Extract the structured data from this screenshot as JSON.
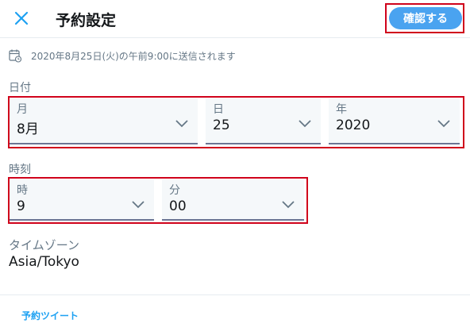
{
  "header": {
    "title": "予約設定",
    "confirm_label": "確認する",
    "close_icon": "close-icon",
    "accent_color": "#1da1f2"
  },
  "schedule": {
    "icon": "calendar-clock-icon",
    "text": "2020年8月25日(火)の午前9:00に送信されます"
  },
  "date": {
    "section_label": "日付",
    "month": {
      "label": "月",
      "value": "8月"
    },
    "day": {
      "label": "日",
      "value": "25"
    },
    "year": {
      "label": "年",
      "value": "2020"
    }
  },
  "time": {
    "section_label": "時刻",
    "hour": {
      "label": "時",
      "value": "9"
    },
    "minute": {
      "label": "分",
      "value": "00"
    }
  },
  "timezone": {
    "label": "タイムゾーン",
    "value": "Asia/Tokyo"
  },
  "footer": {
    "scheduled_tweets_label": "予約ツイート"
  }
}
